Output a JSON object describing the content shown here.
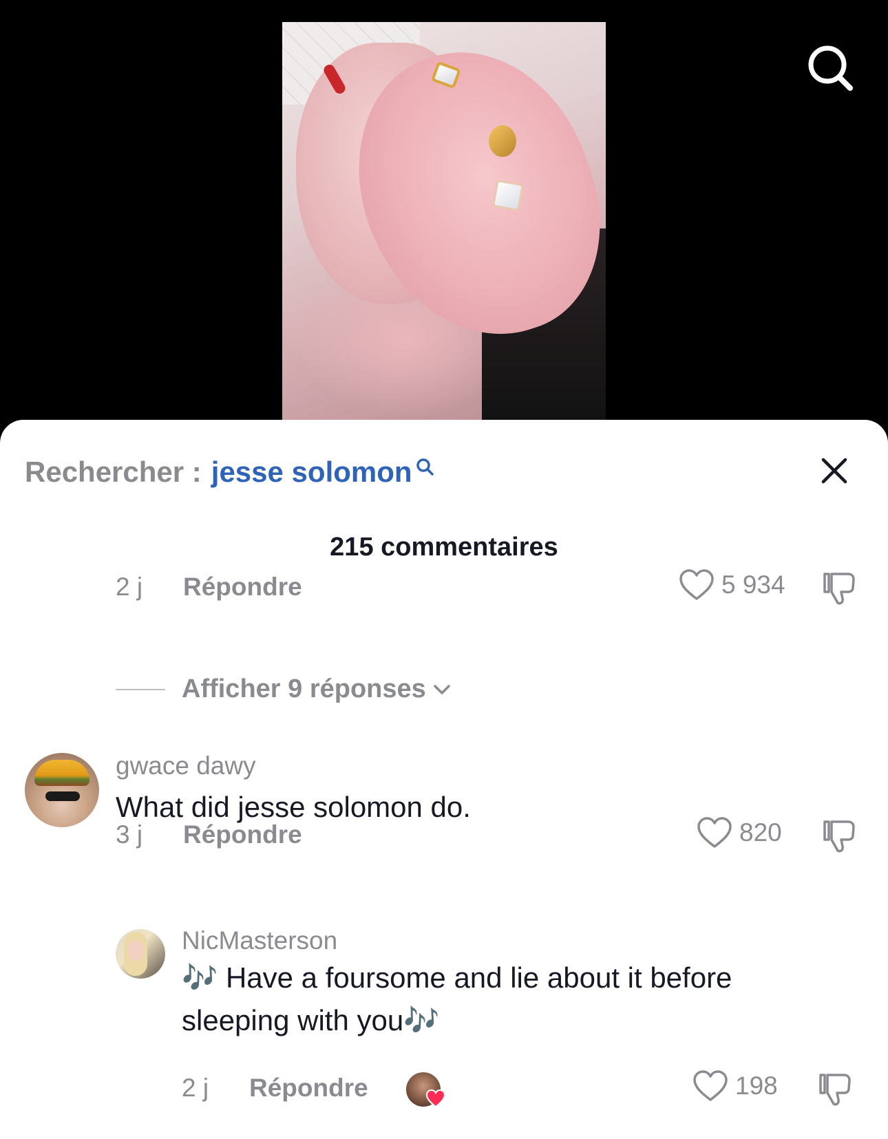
{
  "sheet": {
    "search_prefix": "Rechercher :",
    "search_term": "jesse solomon",
    "comment_count": "215 commentaires"
  },
  "first_comment_meta": {
    "time": "2 j",
    "reply_label": "Répondre",
    "likes": "5 934"
  },
  "replies_toggle": {
    "label": "Afficher 9 réponses"
  },
  "comments": [
    {
      "username": "gwace dawy",
      "text": "What did jesse solomon do.",
      "time": "3 j",
      "reply_label": "Répondre",
      "likes": "820"
    },
    {
      "username": "NicMasterson",
      "text_line1": "🎶 Have a foursome and lie about it before",
      "text_line2": "sleeping with you🎶",
      "time": "2 j",
      "reply_label": "Répondre",
      "likes": "198"
    }
  ],
  "icons": {
    "top_search": "search-icon",
    "close": "close-icon",
    "like": "heart-icon",
    "dislike": "thumbs-down-icon",
    "expand": "chevron-down-icon"
  },
  "colors": {
    "search_term": "#2e63b8",
    "muted_text": "#8a8b91",
    "primary_text": "#161823",
    "liked_heart": "#fe2c55"
  }
}
